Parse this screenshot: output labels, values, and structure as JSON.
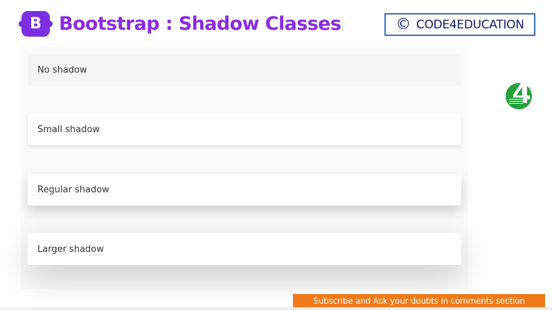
{
  "header": {
    "logo_letter": "B",
    "title": "Bootstrap : Shadow Classes"
  },
  "brand": {
    "copyright_symbol": "©",
    "name": "CODE4EDUCATION"
  },
  "cards": [
    {
      "label": "No shadow"
    },
    {
      "label": "Small shadow"
    },
    {
      "label": "Regular shadow"
    },
    {
      "label": "Larger shadow"
    }
  ],
  "side_logo": {
    "text": "4"
  },
  "footer": {
    "banner": "Subscribe and Ask your doubts in comments section"
  },
  "colors": {
    "bootstrap_purple": "#7b2fe0",
    "title_purple": "#8a2be2",
    "brand_border": "#3a6fb5",
    "brand_text": "#0e1b6b",
    "banner_orange": "#f07a1a",
    "logo_green": "#25a03b"
  }
}
